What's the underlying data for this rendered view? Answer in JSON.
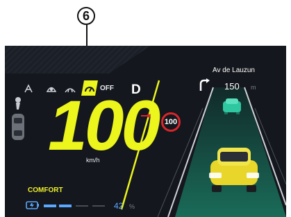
{
  "callout": {
    "number": "6"
  },
  "cluster": {
    "speed": "100",
    "speed_unit": "km/h",
    "gear": "D",
    "cruise_status": "OFF",
    "speed_limit": "100",
    "drive_mode": "COMFORT",
    "battery_percent": "42",
    "battery_percent_symbol": "%",
    "battery_level": 0.42
  },
  "navigation": {
    "street": "Av de Lauzun",
    "distance": "150",
    "distance_unit": "m",
    "maneuver_icon": "turn-right-arrow-icon"
  },
  "colors": {
    "accent_yellow": "#ecf51c",
    "battery_blue": "#5aa8ff",
    "lane_green": "#18a884",
    "limit_red": "#d8262b",
    "background": "#14171d"
  }
}
